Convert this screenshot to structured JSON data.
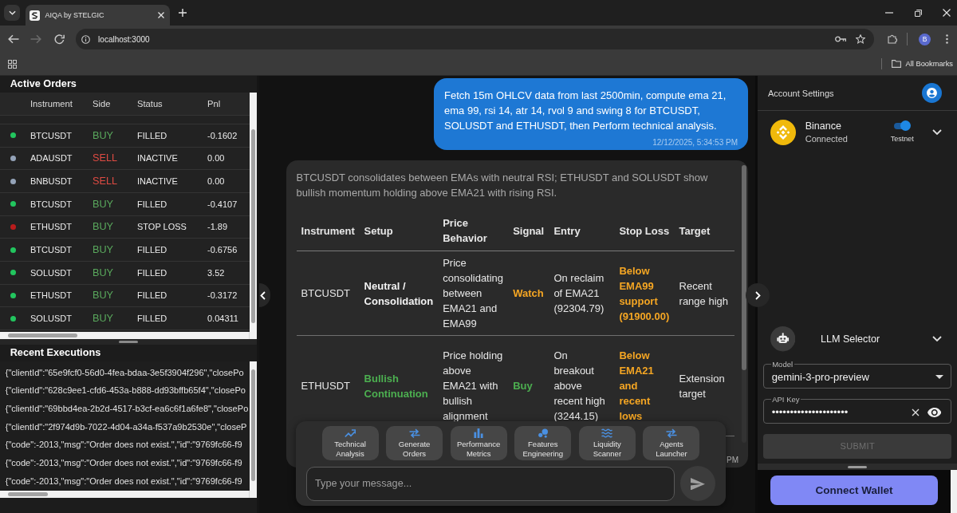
{
  "browser": {
    "tab_title": "AIQA by STELGIC",
    "url": "localhost:3000",
    "forward_enabled": false,
    "profile_initial": "B",
    "bookmarks_label": "All Bookmarks"
  },
  "active_orders": {
    "title": "Active Orders",
    "columns": [
      "Instrument",
      "Side",
      "Status",
      "Pnl"
    ],
    "rows": [
      {
        "color": "#22c55e",
        "instrument": "BTCUSDT",
        "side": "BUY",
        "kind": "buy",
        "status": "FILLED",
        "pnl": "-0.1602"
      },
      {
        "color": "#94a3b8",
        "instrument": "ADAUSDT",
        "side": "SELL",
        "kind": "sell",
        "status": "INACTIVE",
        "pnl": "0.00"
      },
      {
        "color": "#94a3b8",
        "instrument": "BNBUSDT",
        "side": "SELL",
        "kind": "sell",
        "status": "INACTIVE",
        "pnl": "0.00"
      },
      {
        "color": "#22c55e",
        "instrument": "BTCUSDT",
        "side": "BUY",
        "kind": "buy",
        "status": "FILLED",
        "pnl": "-0.4107"
      },
      {
        "color": "#b91c1c",
        "instrument": "ETHUSDT",
        "side": "BUY",
        "kind": "buy",
        "status": "STOP LOSS",
        "pnl": "-1.89"
      },
      {
        "color": "#22c55e",
        "instrument": "BTCUSDT",
        "side": "BUY",
        "kind": "buy",
        "status": "FILLED",
        "pnl": "-0.6756"
      },
      {
        "color": "#22c55e",
        "instrument": "SOLUSDT",
        "side": "BUY",
        "kind": "buy",
        "status": "FILLED",
        "pnl": "3.52"
      },
      {
        "color": "#22c55e",
        "instrument": "ETHUSDT",
        "side": "BUY",
        "kind": "buy",
        "status": "FILLED",
        "pnl": "-0.3172"
      },
      {
        "color": "#22c55e",
        "instrument": "SOLUSDT",
        "side": "BUY",
        "kind": "buy",
        "status": "FILLED",
        "pnl": "0.04311"
      }
    ]
  },
  "recent_executions": {
    "title": "Recent Executions",
    "lines": [
      "{\"clientId\":\"65e9fcf0-56d0-4fea-bdaa-3e5f3904f296\",\"closePo",
      "{\"clientId\":\"628c9ee1-cfd6-453a-b888-dd93bffb65f4\",\"closePo",
      "{\"clientId\":\"69bbd4ea-2b2d-4517-b3cf-ea6c6f1a6fe8\",\"closePo",
      "{\"clientId\":\"2f974d9b-7022-4d04-a34a-f537a9b2530e\",\"closeP",
      "{\"code\":-2013,\"msg\":\"Order does not exist.\",\"id\":\"9769fc66-f9",
      "{\"code\":-2013,\"msg\":\"Order does not exist.\",\"id\":\"9769fc66-f9",
      "{\"code\":-2013,\"msg\":\"Order does not exist.\",\"id\":\"9769fc66-f9"
    ]
  },
  "chat": {
    "user_message": {
      "text": "Fetch 15m OHLCV data from last 2500min, compute ema 21, ema 99, rsi 14, atr 14, rvol 9 and swing 8 for BTCUSDT, SOLUSDT and ETHUSDT, then Perform technical analysis.",
      "time": "12/12/2025, 5:34:53 PM"
    },
    "assistant_message": {
      "summary": "BTCUSDT consolidates between EMAs with neutral RSI; ETHUSDT and SOLUSDT show bullish momentum holding above EMA21 with rising RSI.",
      "columns": [
        "Instrument",
        "Setup",
        "Price Behavior",
        "Signal",
        "Entry",
        "Stop Loss",
        "Target"
      ],
      "rows": [
        {
          "cells": [
            {
              "text": "BTCUSDT",
              "kind": "plain"
            },
            {
              "text": "Neutral / Consolidation",
              "kind": "strong"
            },
            {
              "text": "Price consolidating between EMA21 and EMA99",
              "kind": "plain"
            },
            {
              "text": "Watch",
              "kind": "warning"
            },
            {
              "text": "On reclaim of EMA21 (92304.79)",
              "kind": "plain"
            },
            {
              "text": "Below EMA99 support (91900.00)",
              "kind": "warning"
            },
            {
              "text": "Recent range high",
              "kind": "plain"
            }
          ]
        },
        {
          "cells": [
            {
              "text": "ETHUSDT",
              "kind": "plain"
            },
            {
              "text": "Bullish Continuation",
              "kind": "positive"
            },
            {
              "text": "Price holding above EMA21 with bullish alignment",
              "kind": "plain"
            },
            {
              "text": "Buy",
              "kind": "positive"
            },
            {
              "text": "On breakout above recent high (3244.15)",
              "kind": "plain"
            },
            {
              "text": "Below EMA21 and recent lows",
              "kind": "warning"
            },
            {
              "text": "Extension target",
              "kind": "plain"
            }
          ]
        }
      ],
      "time": "PM"
    },
    "quick_actions": [
      "Technical Analysis",
      "Generate Orders",
      "Performance Metrics",
      "Features Engineering",
      "Liquidity Scanner",
      "Agents Launcher"
    ],
    "input": {
      "placeholder": "Type your message..."
    }
  },
  "account": {
    "title": "Account Settings",
    "exchange": {
      "name": "Binance",
      "status": "Connected",
      "testnet_label": "Testnet",
      "testnet_on": true
    },
    "llm": {
      "title": "LLM Selector",
      "model": {
        "label": "Model",
        "value": "gemini-3-pro-preview"
      },
      "api_key": {
        "label": "API Key",
        "value": "•••••••••••••••••••••"
      },
      "submit": {
        "label": "SUBMIT",
        "disabled": true
      }
    },
    "connect_wallet": {
      "label": "Connect Wallet"
    }
  }
}
